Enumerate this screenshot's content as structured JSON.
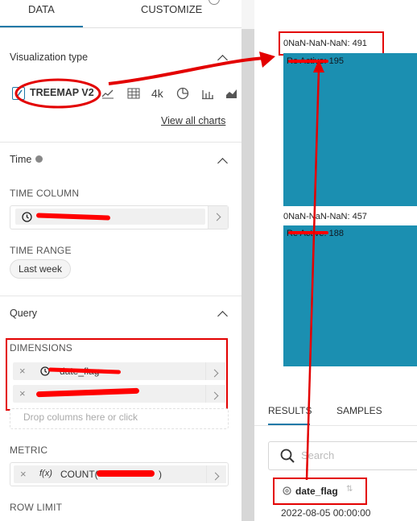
{
  "tabs": {
    "data": "DATA",
    "customize": "CUSTOMIZE"
  },
  "visualization": {
    "section_title": "Visualization type",
    "selected": "TREEMAP V2",
    "chart_icons": [
      "line-chart-icon",
      "table-icon",
      "big-number-icon",
      "pie-chart-icon",
      "bar-chart-icon",
      "area-chart-icon"
    ],
    "big_number_label": "4k",
    "view_all": "View all charts"
  },
  "time": {
    "section_title": "Time",
    "time_column_label": "TIME COLUMN",
    "time_range_label": "TIME RANGE",
    "time_range_value": "Last week"
  },
  "query": {
    "section_title": "Query",
    "dimensions_label": "DIMENSIONS",
    "dimension_1": "date_flag",
    "drop_placeholder": "Drop columns here or click",
    "metric_label": "METRIC",
    "metric_value": "COUNT(",
    "metric_suffix": ")",
    "row_limit_label": "ROW LIMIT"
  },
  "treemap": {
    "group1_header": "0NaN-NaN-NaN: 491",
    "group1_leaf": "Re Active: 195",
    "group2_header": "0NaN-NaN-NaN: 457",
    "group2_leaf": "Re Active: 188"
  },
  "results": {
    "tab_results": "RESULTS",
    "tab_samples": "SAMPLES",
    "search_placeholder": "Search",
    "column_header": "date_flag",
    "first_row": "2022-08-05 00:00:00"
  },
  "colors": {
    "accent": "#1e79a8",
    "treemap_fill": "#1b8fb1",
    "annotation_red": "#e30000"
  }
}
